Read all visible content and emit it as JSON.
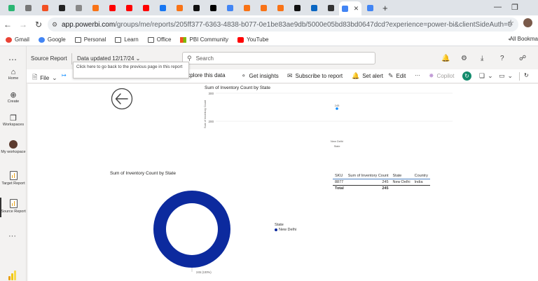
{
  "browser": {
    "tab_favicon_colors": [
      "#2bb673",
      "#777777",
      "#f25022",
      "#222222",
      "#888888",
      "#f97316",
      "#ff0000",
      "#ff0000",
      "#ff0000",
      "#1877f2",
      "#f97316",
      "#111111",
      "#000000",
      "#4285f4",
      "#f97316",
      "#f97316",
      "#f97316",
      "#111111",
      "#0a66c2",
      "#333333",
      "#4285f4"
    ],
    "active_tab_favicon_color": "#4285f4",
    "url_host": "app.powerbi.com",
    "url_path": "/groups/me/reports/205ff377-6363-4838-b077-0e1be83ae9db/5000e05bd83bd0647dcd?experience=power-bi&clientSideAuth=0",
    "bookmarks": [
      {
        "label": "Gmail",
        "icon": "gmail-icon",
        "color": "#ea4335"
      },
      {
        "label": "Google",
        "icon": "google-icon",
        "color": "#4285f4"
      },
      {
        "label": "Personal",
        "icon": "folder-icon"
      },
      {
        "label": "Learn",
        "icon": "folder-icon"
      },
      {
        "label": "Office",
        "icon": "folder-icon"
      },
      {
        "label": "PBI Community",
        "icon": "windows-icon"
      },
      {
        "label": "YouTube",
        "icon": "youtube-icon",
        "color": "#ff0000"
      }
    ],
    "all_bookmarks_label": "All Bookma"
  },
  "leftnav": {
    "items": [
      {
        "label": "Home",
        "icon": "home-icon"
      },
      {
        "label": "Create",
        "icon": "create-icon"
      },
      {
        "label": "Workspaces",
        "icon": "workspaces-icon"
      },
      {
        "label": "My workspace",
        "icon": "avatar"
      },
      {
        "label": "Target Report",
        "icon": "report-icon"
      },
      {
        "label": "Source Report",
        "icon": "report-icon"
      }
    ]
  },
  "header": {
    "report_name": "Source Report",
    "data_updated": "Data updated 12/17/24",
    "search_placeholder": "Search"
  },
  "toolbar": {
    "file": "File",
    "explore": "Explore this data",
    "insights": "Get insights",
    "subscribe": "Subscribe to report",
    "alert": "Set alert",
    "edit": "Edit",
    "more": "···",
    "copilot": "Copilot"
  },
  "tooltip": {
    "text": "Click here to go back to the previous page in this report"
  },
  "chart_data": [
    {
      "type": "scatter",
      "title": "Sum of Inventory Count by State",
      "xlabel": "State",
      "ylabel": "Sum of Inventory Count",
      "categories": [
        "New Delhi"
      ],
      "values": [
        245
      ],
      "data_labels": [
        "245"
      ],
      "yticks": [
        "300",
        "200"
      ],
      "ylim": [
        150,
        300
      ],
      "color": "#118dff"
    },
    {
      "type": "pie",
      "title": "Sum of Inventory Count by State",
      "legend_title": "State",
      "legend_position": "right",
      "slices": [
        {
          "label": "New Delhi",
          "value": 245
        }
      ],
      "data_labels": [
        "245 (100%)"
      ],
      "color": "#0c2a9e"
    },
    {
      "type": "table",
      "columns": [
        "SKU",
        "Sum of Inventory Count",
        "State",
        "Country"
      ],
      "rows": [
        [
          "8877",
          "245",
          "New Delhi",
          "India"
        ]
      ],
      "total": {
        "label": "Total",
        "value": "245"
      }
    }
  ]
}
